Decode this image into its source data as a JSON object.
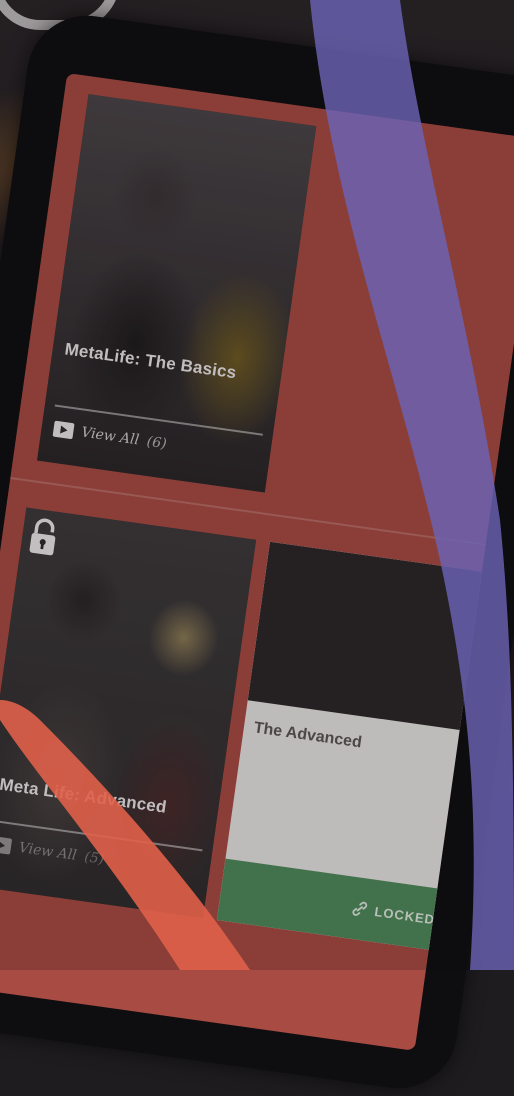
{
  "cards": [
    {
      "title": "MetaLife: The Basics",
      "view_label": "View All",
      "count": "(6)"
    },
    {
      "title": "Meta Life: Advanced",
      "view_label": "View All",
      "count": "(5)"
    },
    {
      "title": "The Advanced",
      "status": "LOCKED"
    }
  ],
  "colors": {
    "screen_bg": "#a84b43",
    "card_dark": "#2e2b2c",
    "locked_green": "#4f8a5b",
    "purple_accent": "#6a63b5",
    "orange_accent": "#e0614a"
  },
  "icons": [
    "play-icon",
    "lock-icon",
    "link-icon"
  ]
}
